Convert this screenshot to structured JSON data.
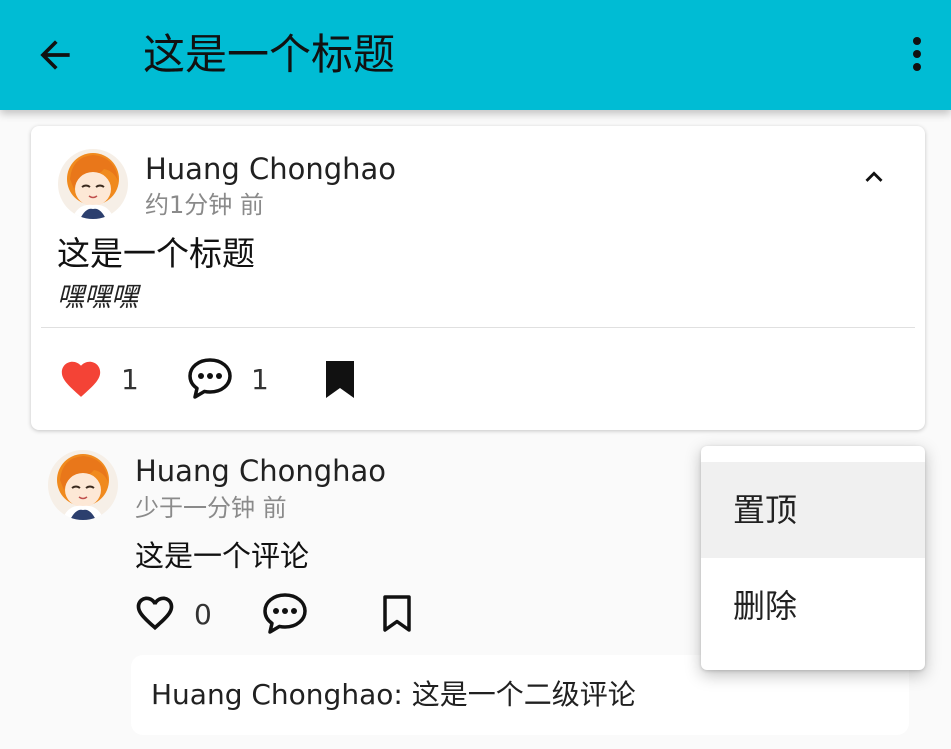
{
  "appbar": {
    "title": "这是一个标题",
    "back_icon": "arrow-back-icon",
    "more_icon": "more-vert-icon",
    "bg_color": "#00bcd4"
  },
  "post": {
    "author": "Huang Chonghao",
    "time": "约1分钟 前",
    "title": "这是一个标题",
    "body": "嘿嘿嘿",
    "likes": "1",
    "comments": "1",
    "liked": true,
    "like_color": "#f44336"
  },
  "comment": {
    "author": "Huang Chonghao",
    "time": "少于一分钟 前",
    "text": "这是一个评论",
    "likes": "0",
    "reply": "Huang Chonghao: 这是一个二级评论"
  },
  "menu": {
    "items": [
      {
        "label": "置顶"
      },
      {
        "label": "删除"
      }
    ]
  }
}
